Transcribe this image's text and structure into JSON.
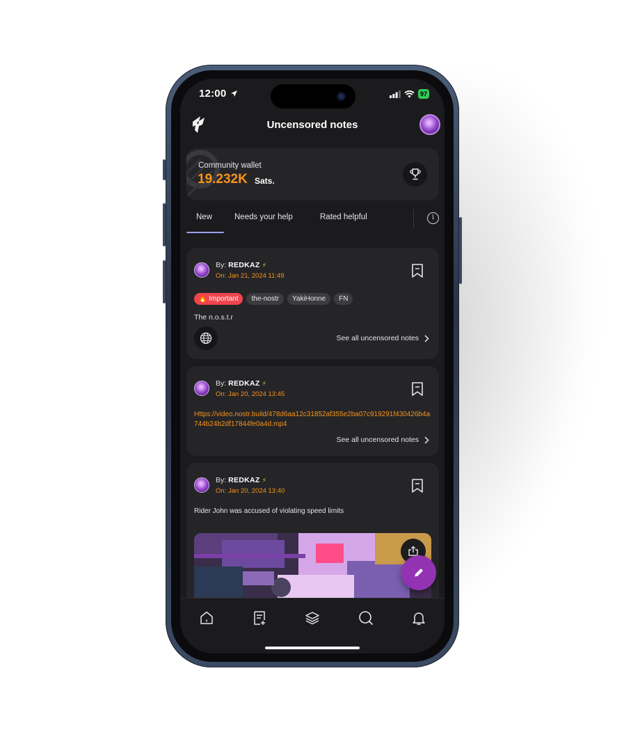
{
  "status_bar": {
    "time": "12:00",
    "battery": "97"
  },
  "header": {
    "title": "Uncensored notes"
  },
  "wallet": {
    "label": "Community wallet",
    "amount": "19.232K",
    "unit": "Sats."
  },
  "tabs": [
    {
      "label": "New",
      "active": true
    },
    {
      "label": "Needs your help",
      "active": false
    },
    {
      "label": "Rated helpful",
      "active": false
    }
  ],
  "info_icon": "i",
  "cards": [
    {
      "by_prefix": "By:",
      "author": "REDKAZ",
      "date": "On: Jan 21, 2024 11:49",
      "tags": [
        "Important",
        "the-nostr",
        "YakiHonne",
        "FN"
      ],
      "text": "The n.o.s.t.r",
      "see_all": "See all uncensored notes"
    },
    {
      "by_prefix": "By:",
      "author": "REDKAZ",
      "date": "On: Jan 20, 2024 13:45",
      "link": "Https://video.nostr.build/478d6aa12c31852af355e2ba07c919291f430426b4a744b24b2df17844fe0a4d.mp4",
      "see_all": "See all uncensored notes"
    },
    {
      "by_prefix": "By:",
      "author": "REDKAZ",
      "date": "On: Jan 20, 2024 13:40",
      "text": "Rider John was accused of violating speed limits"
    }
  ],
  "icons": {
    "logo": "yakihonne-logo-icon",
    "trophy": "trophy-icon",
    "bookmark": "bookmark-icon",
    "globe": "globe-icon",
    "chevron": "chevron-right-icon",
    "share": "share-icon",
    "compose": "pencil-icon",
    "nav": [
      "home-icon",
      "notes-icon",
      "layers-icon",
      "search-icon",
      "bell-icon"
    ]
  },
  "colors": {
    "accent": "#f7931a",
    "fab": "#9333b4",
    "important": "#f0454e",
    "tab_underline": "#9aa0f0"
  }
}
